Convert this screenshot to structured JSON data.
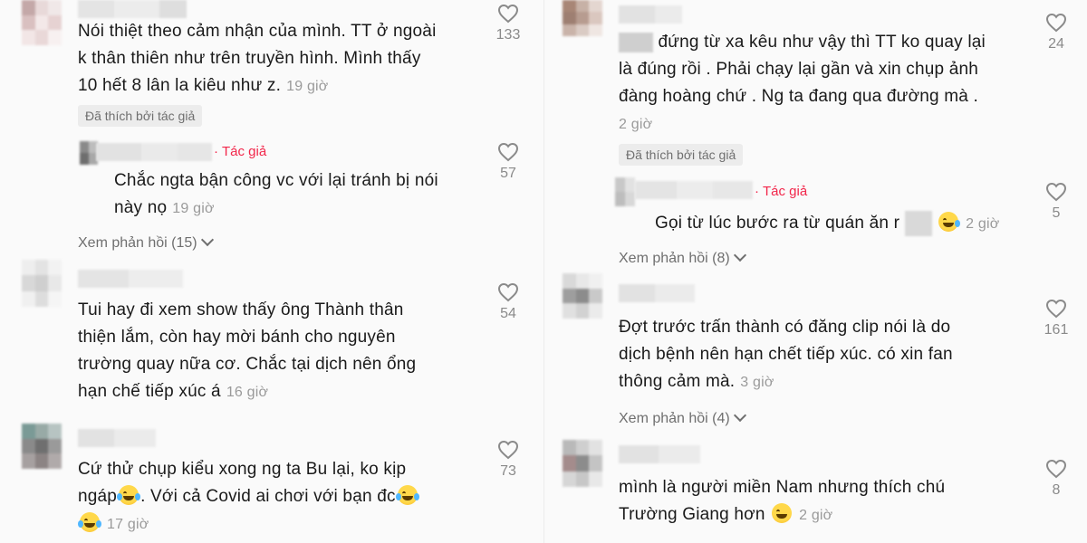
{
  "left": {
    "c1": {
      "lines": [
        "Nói thiệt theo cảm nhận của mình. TT ở ngoài",
        "k thân thiên như trên truyền hình. Mình thấy",
        "10 hết 8 lân la kiêu như z."
      ],
      "time": "19 giờ",
      "liked_badge": "Đã thích bởi tác giả",
      "likes": "133"
    },
    "r1": {
      "author_tag": "Tác giả",
      "lines": [
        "Chắc ngta bận công vc với lại tránh bị nói",
        "này nọ"
      ],
      "time": "19 giờ",
      "likes": "57"
    },
    "more1": "Xem phản hồi (15)",
    "c2": {
      "lines": [
        "Tui hay đi xem show thấy ông Thành thân",
        "thiện lắm, còn hay mời bánh cho nguyên",
        "trường quay nữa cơ. Chắc tại dịch nên ổng",
        "hạn chế tiếp xúc á"
      ],
      "time": "16 giờ",
      "likes": "54"
    },
    "c3": {
      "lines": [
        "Cứ thử chụp kiểu xong ng ta Bu lại, ko kịp",
        "ngáp",
        ". Với cả Covid ai chơi với bạn đc"
      ],
      "time": "17 giờ",
      "likes": "73"
    }
  },
  "right": {
    "c1": {
      "lines": [
        "đứng từ xa kêu như vậy thì TT ko quay lại",
        "là đúng rồi . Phải chạy lại gần và xin chụp ảnh",
        "đàng hoàng chứ . Ng ta đang qua đường mà ."
      ],
      "time": "2 giờ",
      "liked_badge": "Đã thích bởi tác giả",
      "likes": "24"
    },
    "r1": {
      "author_tag": "Tác giả",
      "line": "Gọi từ lúc bước ra từ quán ăn r",
      "time": "2 giờ",
      "likes": "5"
    },
    "more1": "Xem phản hồi (8)",
    "c2": {
      "lines": [
        "Đợt trước trấn thành có đăng clip nói là do",
        "dịch bệnh nên hạn chết tiếp xúc. có xin fan",
        "thông cảm mà."
      ],
      "time": "3 giờ",
      "likes": "161"
    },
    "more2": "Xem phản hồi (4)",
    "c3": {
      "lines": [
        "mình là người miền Nam nhưng thích chú",
        "Trường Giang hơn"
      ],
      "time": "2 giờ",
      "likes": "8"
    }
  },
  "icons": {
    "like": "heart-outline-icon",
    "expand": "chevron-down-icon",
    "laugh": "tears-of-joy-emoji",
    "grin": "grinning-emoji"
  },
  "colors": {
    "author_tag": "#f2264a",
    "muted": "#9a9a9a",
    "badge_bg": "#ececec"
  }
}
